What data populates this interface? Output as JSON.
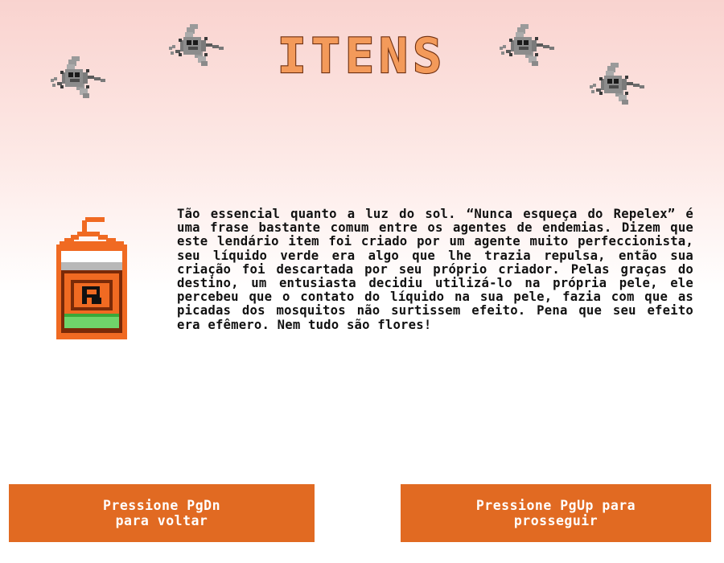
{
  "screen": {
    "title": "ITENS"
  },
  "item": {
    "icon": "repellent-bottle-icon",
    "badge_letter": "R",
    "description": "Tão essencial quanto a luz do sol. “Nunca esqueça do Repelex” é uma frase bastante comum entre os agentes de endemias. Dizem que este lendário item foi criado por um agente muito perfeccionista, seu líquido verde era algo que lhe trazia repulsa, então sua criação foi descartada por seu próprio criador. Pelas graças do destino, um entusiasta decidiu utilizá-lo na própria pele, ele percebeu que o contato do líquido na sua pele, fazia com que as picadas dos mosquitos não surtissem efeito. Pena que seu efeito era efêmero. Nem tudo são flores!"
  },
  "navigation": {
    "back_label": "Pressione PgDn\npara voltar",
    "next_label": "Pressione PgUp para\nprosseguir"
  },
  "decorations": {
    "icon": "mosquito-icon",
    "count": 4
  },
  "colors": {
    "title_fill": "#f39a5a",
    "title_outline": "#6e2f10",
    "button_bg": "#e16a22",
    "button_text": "#ffffff",
    "bottle_orange": "#f06a22",
    "bottle_liquid": "#6fd46a",
    "background_top": "#f9d3cf"
  }
}
